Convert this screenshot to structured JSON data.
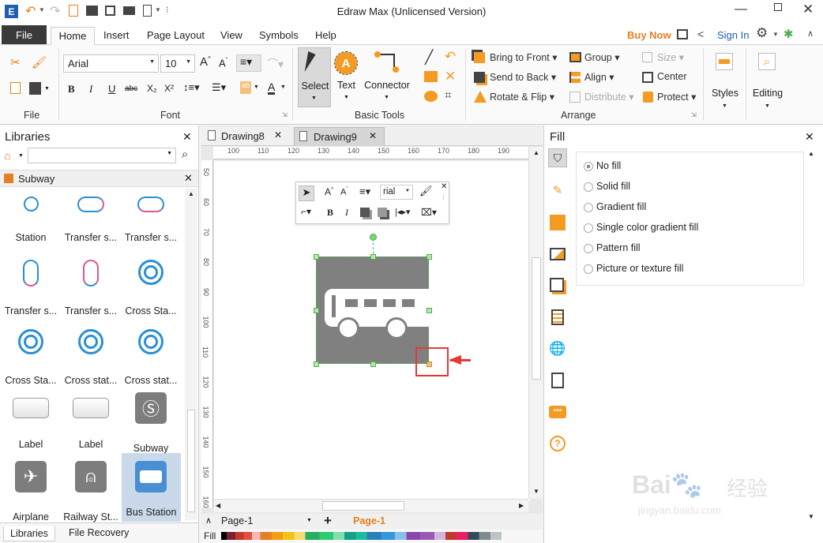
{
  "window": {
    "title": "Edraw Max (Unlicensed Version)"
  },
  "menu_tabs": [
    "File",
    "Home",
    "Insert",
    "Page Layout",
    "View",
    "Symbols",
    "Help"
  ],
  "account": {
    "buy_now": "Buy Now",
    "sign_in": "Sign In"
  },
  "font": {
    "family": "Arial",
    "size": "10"
  },
  "groups": {
    "file": "File",
    "font": "Font",
    "basic_tools": "Basic Tools",
    "arrange": "Arrange"
  },
  "tools": {
    "select": "Select",
    "text": "Text",
    "connector": "Connector",
    "styles": "Styles",
    "editing": "Editing"
  },
  "arrange": {
    "bring_front": "Bring to Front",
    "send_back": "Send to Back",
    "rotate_flip": "Rotate & Flip",
    "group": "Group",
    "align": "Align",
    "distribute": "Distribute",
    "size": "Size",
    "center": "Center",
    "protect": "Protect"
  },
  "libraries": {
    "title": "Libraries",
    "category": "Subway",
    "items": [
      "Station",
      "Transfer s...",
      "Transfer s...",
      "Transfer s...",
      "Transfer s...",
      "Cross Sta...",
      "Cross Sta...",
      "Cross stat...",
      "Cross stat...",
      "Label",
      "Label",
      "Subway",
      "Airplane",
      "Railway St...",
      "Bus Station"
    ],
    "bottom_tabs": [
      "Libraries",
      "File Recovery"
    ]
  },
  "doc_tabs": [
    "Drawing8",
    "Drawing9"
  ],
  "ruler_h": [
    "100",
    "110",
    "120",
    "130",
    "140",
    "150",
    "160",
    "170",
    "180",
    "190"
  ],
  "ruler_v": [
    "50",
    "60",
    "70",
    "80",
    "90",
    "100",
    "110",
    "120",
    "130",
    "140",
    "150",
    "160"
  ],
  "float_toolbar": {
    "font": "rial"
  },
  "pages": {
    "current": "Page-1",
    "active_tab": "Page-1"
  },
  "fill_strip_label": "Fill",
  "fill_panel": {
    "title": "Fill",
    "options": [
      "No fill",
      "Solid fill",
      "Gradient fill",
      "Single color gradient fill",
      "Pattern fill",
      "Picture or texture fill"
    ],
    "selected": "No fill"
  },
  "watermark": {
    "brand": "Bai",
    "brand2": "经验",
    "url": "jingyan.baidu.com"
  },
  "colors": {
    "accent": "#2b579a",
    "orange": "#f59a23",
    "shape_gray": "#808080",
    "selection": "#4caf50",
    "highlight": "#e53935"
  }
}
